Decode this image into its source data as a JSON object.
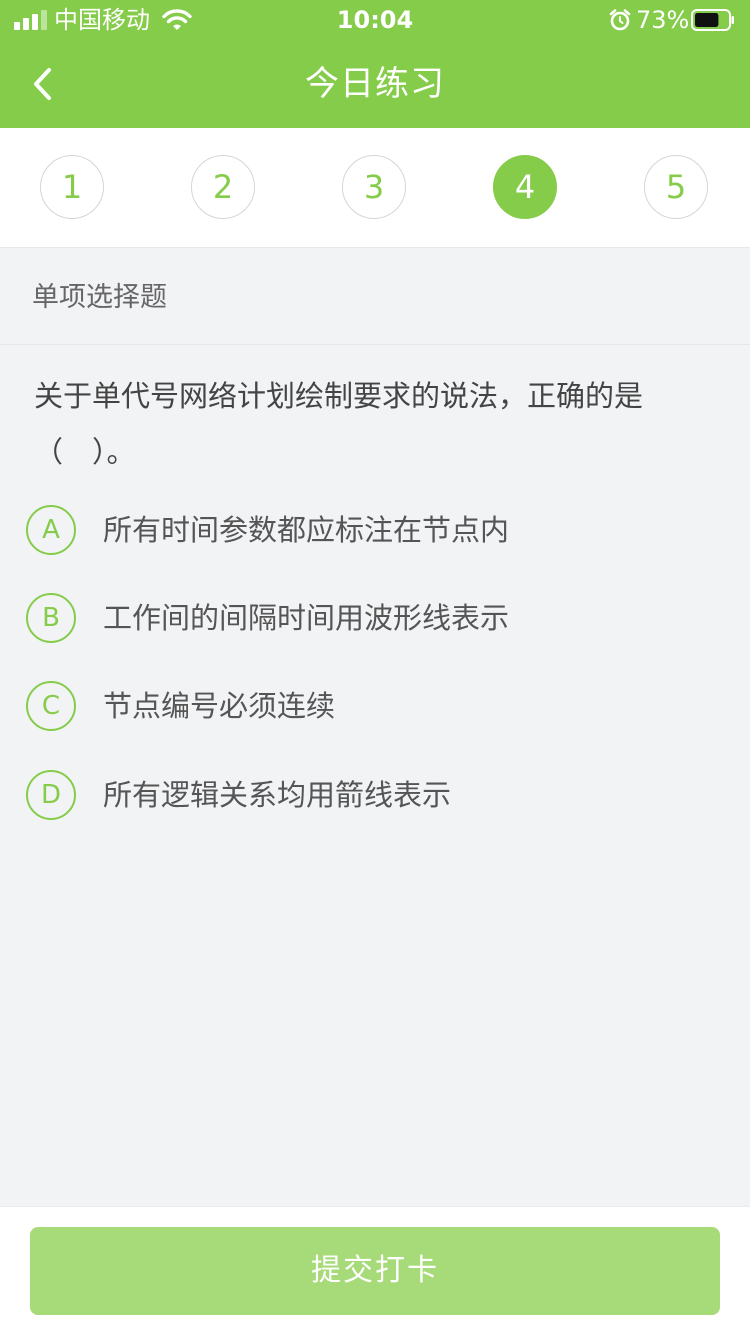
{
  "status_bar": {
    "carrier": "中国移动",
    "time": "10:04",
    "battery_percent": "73%",
    "battery_level": 0.73,
    "icons": [
      "signal-icon",
      "wifi-icon",
      "alarm-icon",
      "battery-icon"
    ]
  },
  "nav": {
    "back_icon": "chevron-left-icon",
    "title": "今日练习"
  },
  "steps": {
    "items": [
      "1",
      "2",
      "3",
      "4",
      "5"
    ],
    "active": "4"
  },
  "question": {
    "type_label": "单项选择题",
    "text": "关于单代号网络计划绘制要求的说法，正确的是（　）。",
    "options": [
      {
        "letter": "A",
        "text": "所有时间参数都应标注在节点内"
      },
      {
        "letter": "B",
        "text": "工作间的间隔时间用波形线表示"
      },
      {
        "letter": "C",
        "text": "节点编号必须连续"
      },
      {
        "letter": "D",
        "text": "所有逻辑关系均用箭线表示"
      }
    ]
  },
  "footer": {
    "submit_label": "提交打卡"
  },
  "colors": {
    "accent": "#86cc4b",
    "accent_light": "#a7da78",
    "background": "#f2f3f5"
  }
}
